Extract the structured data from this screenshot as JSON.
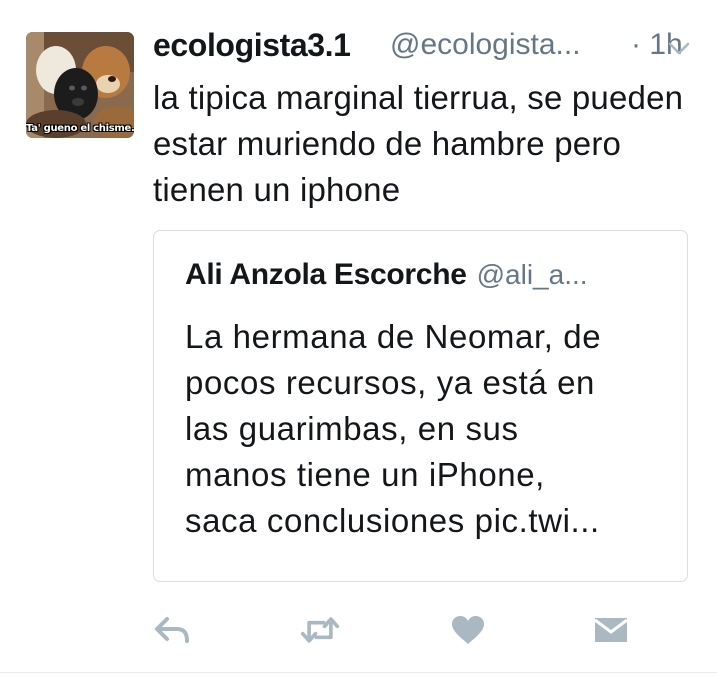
{
  "tweet": {
    "avatar": {
      "caption": "Ta' gueno el chisme."
    },
    "author": {
      "display_name": "ecologista3.1",
      "handle": "@ecologista...",
      "time": "· 1h"
    },
    "text": "la tipica marginal tierrua, se pueden estar muriendo de hambre pero tienen un iphone",
    "quoted": {
      "display_name": "Ali Anzola Escorche",
      "handle": "@ali_a...",
      "text": "La hermana de Neomar, de\npocos recursos, ya está en\nlas guarimbas, en sus\nmanos tiene un iPhone,\nsaca  conclusiones pic.twi..."
    },
    "actions": [
      {
        "icon": "reply-icon"
      },
      {
        "icon": "retweet-icon"
      },
      {
        "icon": "like-icon"
      },
      {
        "icon": "direct-message-icon"
      }
    ]
  },
  "colors": {
    "text": "#14171a",
    "secondary": "#657786",
    "icon": "#aab8c2",
    "border": "#d9dee2"
  }
}
